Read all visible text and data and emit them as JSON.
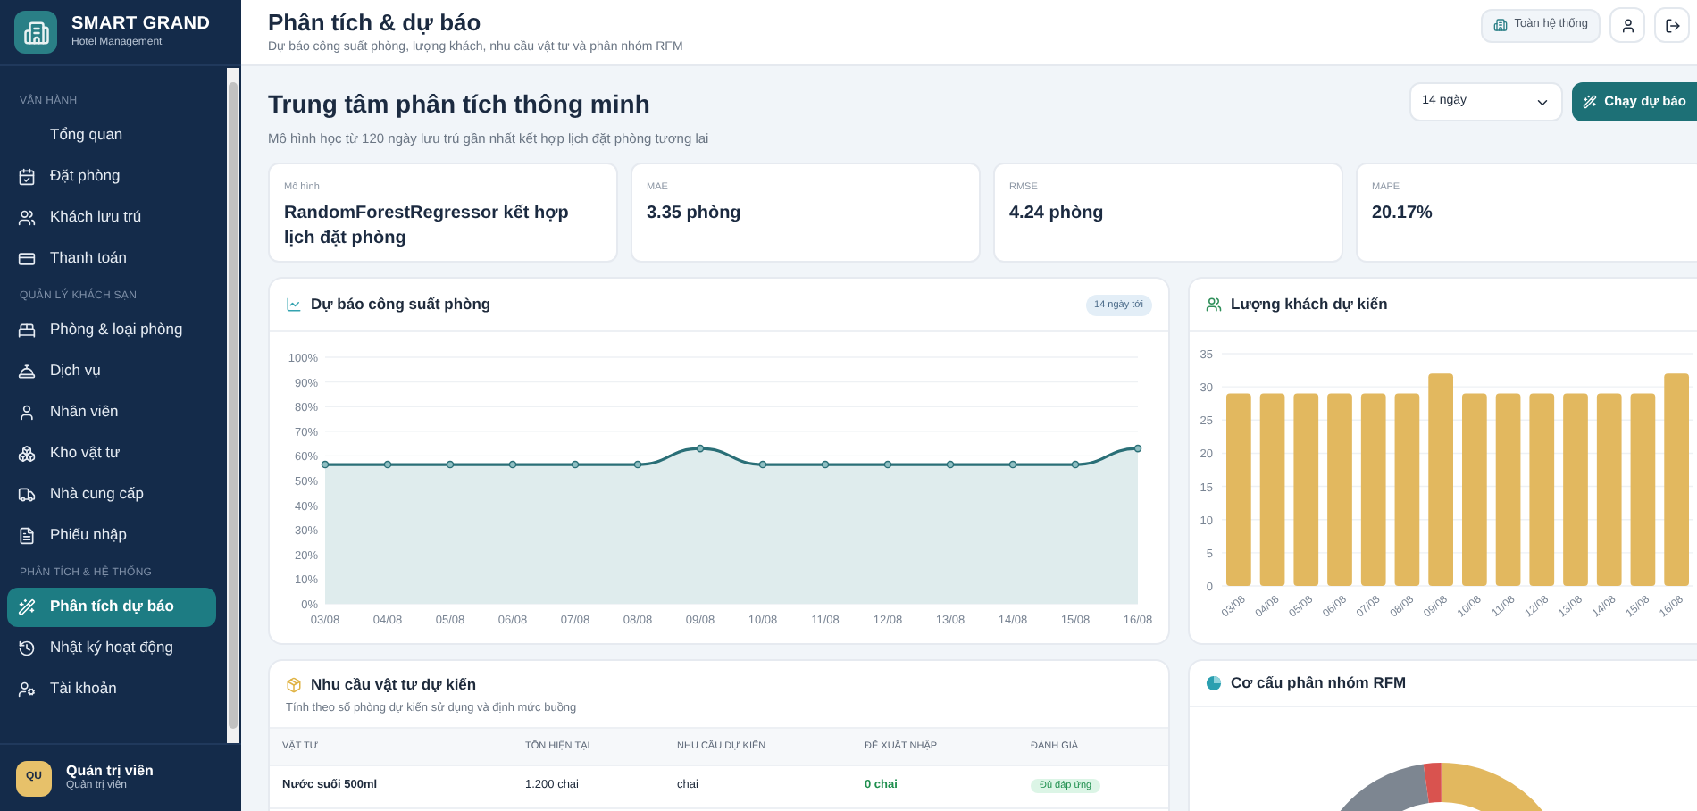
{
  "brand": {
    "name": "SMART GRAND",
    "subtitle": "Hotel Management"
  },
  "sidebar": {
    "sections": [
      {
        "title": "VẬN HÀNH",
        "items": [
          {
            "label": "Tổng quan",
            "selected": false
          },
          {
            "label": "Đặt phòng",
            "selected": false
          },
          {
            "label": "Khách lưu trú",
            "selected": false
          },
          {
            "label": "Thanh toán",
            "selected": false
          }
        ]
      },
      {
        "title": "QUẢN LÝ KHÁCH SẠN",
        "items": [
          {
            "label": "Phòng & loại phòng",
            "selected": false
          },
          {
            "label": "Dịch vụ",
            "selected": false
          },
          {
            "label": "Nhân viên",
            "selected": false
          },
          {
            "label": "Kho vật tư",
            "selected": false
          },
          {
            "label": "Nhà cung cấp",
            "selected": false
          },
          {
            "label": "Phiếu nhập",
            "selected": false
          }
        ]
      },
      {
        "title": "PHÂN TÍCH & HỆ THỐNG",
        "items": [
          {
            "label": "Phân tích dự báo",
            "selected": true
          },
          {
            "label": "Nhật ký hoạt động",
            "selected": false
          },
          {
            "label": "Tài khoản",
            "selected": false
          }
        ]
      }
    ],
    "user": {
      "initials": "QU",
      "name": "Quản trị viên",
      "role": "Quản trị viên"
    }
  },
  "header": {
    "title": "Phân tích & dự báo",
    "subtitle": "Dự báo công suất phòng, lượng khách, nhu cầu vật tư và phân nhóm RFM",
    "scope_button": "Toàn hệ thống"
  },
  "hero": {
    "title": "Trung tâm phân tích thông minh",
    "subtitle": "Mô hình học từ 120 ngày lưu trú gần nhất kết hợp lịch đặt phòng tương lai",
    "period_select": "14 ngày",
    "run_button": "Chạy dự báo"
  },
  "metrics": [
    {
      "label": "Mô hình",
      "value": "RandomForestRegressor kết hợp lịch đặt phòng"
    },
    {
      "label": "MAE",
      "value": "3.35 phòng"
    },
    {
      "label": "RMSE",
      "value": "4.24 phòng"
    },
    {
      "label": "MAPE",
      "value": "20.17%"
    }
  ],
  "occupancy": {
    "title": "Dự báo công suất phòng",
    "badge": "14 ngày tới",
    "chart_data": {
      "type": "area",
      "grid": true,
      "categories": [
        "03/08",
        "04/08",
        "05/08",
        "06/08",
        "07/08",
        "08/08",
        "09/08",
        "10/08",
        "11/08",
        "12/08",
        "13/08",
        "14/08",
        "15/08",
        "16/08"
      ],
      "series": [
        {
          "color": "#2a6f77",
          "values": [
            56.5,
            56.5,
            56.5,
            56.5,
            56.5,
            56.5,
            63,
            56.5,
            56.5,
            56.5,
            56.5,
            56.5,
            56.5,
            63
          ]
        }
      ],
      "ylim": [
        0,
        100
      ],
      "yticks": [
        {
          "value": 0,
          "label": "0%"
        },
        {
          "value": 10,
          "label": "10%"
        },
        {
          "value": 20,
          "label": "20%"
        },
        {
          "value": 30,
          "label": "30%"
        },
        {
          "value": 40,
          "label": "40%"
        },
        {
          "value": 50,
          "label": "50%"
        },
        {
          "value": 60,
          "label": "60%"
        },
        {
          "value": 70,
          "label": "70%"
        },
        {
          "value": 80,
          "label": "80%"
        },
        {
          "value": 90,
          "label": "90%"
        },
        {
          "value": 100,
          "label": "100%"
        }
      ]
    }
  },
  "guests": {
    "title": "Lượng khách dự kiến",
    "chart_data": {
      "type": "bar",
      "grid": true,
      "categories": [
        "03/08",
        "04/08",
        "05/08",
        "06/08",
        "07/08",
        "08/08",
        "09/08",
        "10/08",
        "11/08",
        "12/08",
        "13/08",
        "14/08",
        "15/08",
        "16/08"
      ],
      "series": [
        {
          "color": "#e2b85f",
          "values": [
            29,
            29,
            29,
            29,
            29,
            29,
            32,
            29,
            29,
            29,
            29,
            29,
            29,
            32
          ]
        }
      ],
      "ylim": [
        0,
        35
      ],
      "yticks": [
        0,
        5,
        10,
        15,
        20,
        25,
        30,
        35
      ]
    }
  },
  "supplies": {
    "title": "Nhu cầu vật tư dự kiến",
    "subtitle": "Tính theo số phòng dự kiến sử dụng và định mức buồng",
    "columns": [
      "VẬT TƯ",
      "TỒN HIỆN TẠI",
      "NHU CẦU DỰ KIẾN",
      "ĐỀ XUẤT NHẬP",
      "ĐÁNH GIÁ"
    ],
    "rows": [
      {
        "item": "Nước suối 500ml",
        "stock": "1.200 chai",
        "demand": "chai",
        "suggest": "0 chai",
        "status": "Đủ đáp ứng"
      }
    ]
  },
  "rfm": {
    "title": "Cơ cấu phân nhóm RFM"
  }
}
